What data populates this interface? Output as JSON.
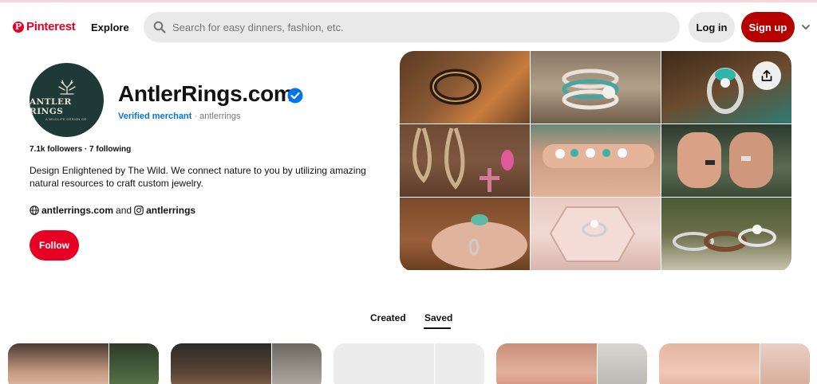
{
  "header": {
    "logo": "Pinterest",
    "explore": "Explore",
    "search_placeholder": "Search for easy dinners, fashion, etc.",
    "login": "Log in",
    "signup": "Sign up"
  },
  "profile": {
    "avatar_text": "ANTLER RINGS",
    "avatar_subtext": "A WILDLIFE DESIGN CO.",
    "name": "AntlerRings.com",
    "merchant_label": "Verified merchant",
    "separator": "·",
    "handle": "antlerrings",
    "stats": "7.1k followers · 7 following",
    "bio": "Design Enlightened by The Wild. We connect nature to you by utilizing amazing natural resources to craft custom jewelry.",
    "website": "antlerrings.com",
    "and": "and",
    "instagram": "antlerrings",
    "follow": "Follow"
  },
  "tabs": {
    "created": "Created",
    "saved": "Saved",
    "active": "saved"
  },
  "colors": {
    "brand_red": "#e60023",
    "signup_red": "#b60000",
    "verified_blue": "#0074e8",
    "avatar_bg": "#1f3a36"
  }
}
